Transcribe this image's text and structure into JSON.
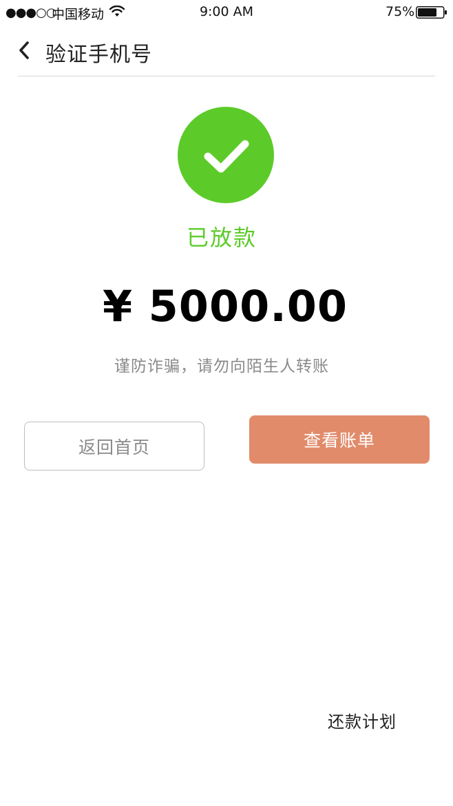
{
  "status_bar": {
    "signal": "●●●○○",
    "carrier": "中国移动",
    "time": "9:00 AM",
    "battery": "75%",
    "battery_level": 0.75
  },
  "nav": {
    "title": "验证手机号"
  },
  "result": {
    "status": "已放款",
    "amount": "¥ 5000.00",
    "warning": "谨防诈骗，请勿向陌生人转账"
  },
  "actions": {
    "home_label": "返回首页",
    "bill_label": "查看账单"
  },
  "footer": {
    "plan_label": "还款计划"
  },
  "colors": {
    "success": "#5ccb29",
    "primary_button": "#e18b6b"
  },
  "icons": [
    "wifi-icon",
    "battery-icon",
    "back-icon",
    "check-circle-icon"
  ]
}
